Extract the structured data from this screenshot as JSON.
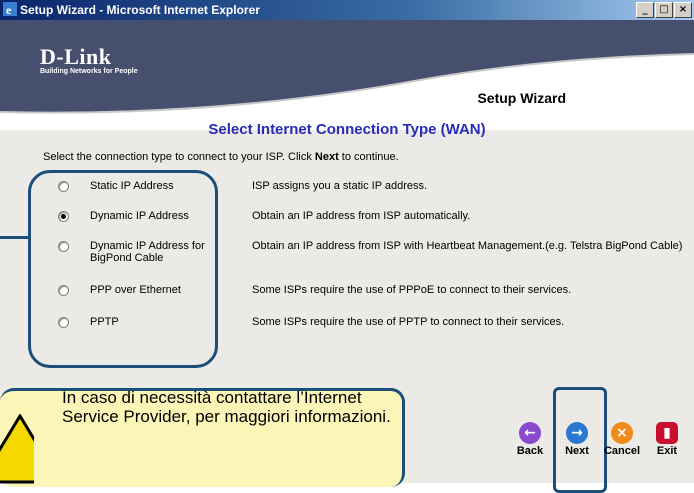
{
  "window": {
    "title": "Setup Wizard - Microsoft Internet Explorer",
    "controls": [
      "_",
      "□",
      "×"
    ]
  },
  "brand": {
    "name": "D-Link",
    "tagline": "Building Networks for People"
  },
  "wizard": {
    "title": "Setup Wizard",
    "section_title": "Select Internet Connection Type (WAN)",
    "instruction_pre": "Select the connection type to connect to your ISP. Click ",
    "instruction_bold": "Next",
    "instruction_post": " to continue."
  },
  "options": [
    {
      "label": "Static IP Address",
      "desc": "ISP assigns you a static IP address.",
      "selected": false
    },
    {
      "label": "Dynamic IP Address",
      "desc": "Obtain an IP address from ISP automatically.",
      "selected": true
    },
    {
      "label": "Dynamic IP Address for BigPond Cable",
      "desc": "Obtain an IP address from ISP with Heartbeat Management.(e.g. Telstra BigPond Cable)",
      "selected": false
    },
    {
      "label": "PPP over Ethernet",
      "desc": "Some ISPs require the use of PPPoE to connect to their services.",
      "selected": false
    },
    {
      "label": "PPTP",
      "desc": "Some ISPs require the use of PPTP to connect to their services.",
      "selected": false
    }
  ],
  "note": {
    "text": "In caso di necessità contattare l’Internet Service Provider, per maggiori informazioni."
  },
  "nav": {
    "back": "Back",
    "next": "Next",
    "cancel": "Cancel",
    "exit": "Exit"
  },
  "colors": {
    "header": "#46506e",
    "section_title": "#2a2ab8",
    "highlight": "#1c4e7a",
    "note_bg": "#fbf6b8"
  }
}
